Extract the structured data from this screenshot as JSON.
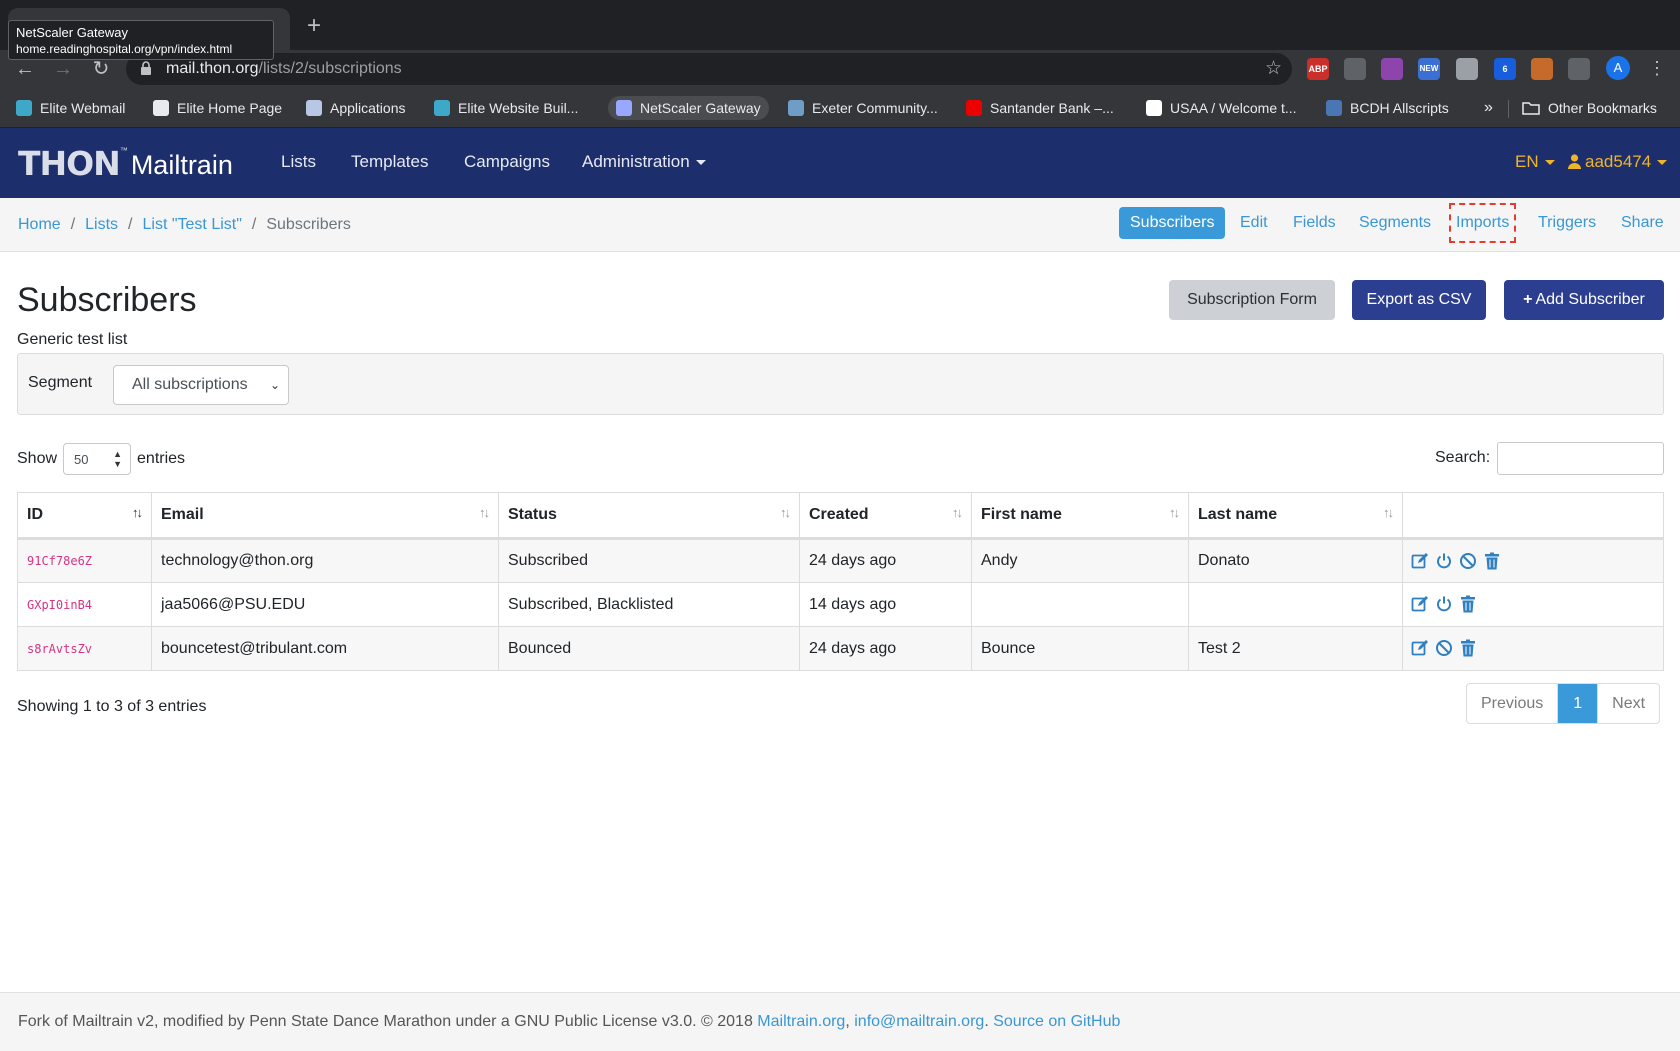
{
  "browser": {
    "tooltip_title": "NetScaler Gateway",
    "tooltip_url": "home.readinghospital.org/vpn/index.html",
    "url_host": "mail.thon.org",
    "url_path": "/lists/2/subscriptions",
    "extensions": [
      {
        "name": "adblock-plus",
        "label": "ABP",
        "color": "#c9302c"
      },
      {
        "name": "office",
        "label": "",
        "color": "#5f6368"
      },
      {
        "name": "color-wheel",
        "label": "",
        "color": "#8e44ad"
      },
      {
        "name": "new-extension",
        "label": "NEW",
        "color": "#3b6fd1"
      },
      {
        "name": "globe-extension",
        "label": "",
        "color": "#9aa0a6"
      },
      {
        "name": "bitwarden",
        "label": "6",
        "color": "#175ddc"
      },
      {
        "name": "basketball-extension",
        "label": "",
        "color": "#c56a2b"
      },
      {
        "name": "puzzle-extension",
        "label": "",
        "color": "#5f6368"
      }
    ],
    "avatar_letter": "A",
    "bookmarks": [
      {
        "label": "Elite Webmail",
        "icon_color": "#3ea8c9"
      },
      {
        "label": "Elite Home Page",
        "icon_color": "#e8eaed"
      },
      {
        "label": "Applications",
        "icon_color": "#b9c7e6"
      },
      {
        "label": "Elite Website Buil...",
        "icon_color": "#3ea8c9"
      },
      {
        "label": "NetScaler Gateway",
        "icon_color": "#9aa7ff"
      },
      {
        "label": "Exeter Community...",
        "icon_color": "#6e9dc7"
      },
      {
        "label": "Santander Bank –...",
        "icon_color": "#ec0000"
      },
      {
        "label": "USAA / Welcome t...",
        "icon_color": "#ffffff"
      },
      {
        "label": "BCDH Allscripts",
        "icon_color": "#4a77b3"
      }
    ],
    "bookmarks_more": "»",
    "other_bookmarks": "Other Bookmarks"
  },
  "nav": {
    "logo_thon": "THON",
    "logo_tm": "™",
    "logo_mailtrain": "Mailtrain",
    "links": [
      "Lists",
      "Templates",
      "Campaigns",
      "Administration"
    ],
    "lang": "EN",
    "user": "aad5474"
  },
  "breadcrumb": {
    "items": [
      "Home",
      "Lists",
      "List \"Test List\"",
      "Subscribers"
    ],
    "separator": "/"
  },
  "tabs": [
    "Subscribers",
    "Edit",
    "Fields",
    "Segments",
    "Imports",
    "Triggers",
    "Share"
  ],
  "page": {
    "title": "Subscribers",
    "subtitle": "Generic test list",
    "buttons": {
      "subscription_form": "Subscription Form",
      "export_csv": "Export as CSV",
      "add_subscriber": "Add Subscriber"
    },
    "segment_label": "Segment",
    "segment_value": "All subscriptions"
  },
  "datatable": {
    "show_label": "Show",
    "page_length": "50",
    "entries_label": "entries",
    "search_label": "Search:",
    "columns": [
      "ID",
      "Email",
      "Status",
      "Created",
      "First name",
      "Last name",
      ""
    ],
    "rows": [
      {
        "id": "91Cf78e6Z",
        "email": "technology@thon.org",
        "status": "Subscribed",
        "created": "24 days ago",
        "first": "Andy",
        "last": "Donato",
        "actions": [
          "edit-icon",
          "power-icon",
          "ban-icon",
          "trash-icon"
        ]
      },
      {
        "id": "GXpI0inB4",
        "email": "jaa5066@PSU.EDU",
        "status": "Subscribed, Blacklisted",
        "created": "14 days ago",
        "first": "",
        "last": "",
        "actions": [
          "edit-icon",
          "power-icon",
          "trash-icon"
        ]
      },
      {
        "id": "s8rAvtsZv",
        "email": "bouncetest@tribulant.com",
        "status": "Bounced",
        "created": "24 days ago",
        "first": "Bounce",
        "last": "Test 2",
        "actions": [
          "edit-icon",
          "ban-icon",
          "trash-icon"
        ]
      }
    ],
    "info": "Showing 1 to 3 of 3 entries",
    "pager": {
      "previous": "Previous",
      "current": "1",
      "next": "Next"
    }
  },
  "footer": {
    "text": "Fork of Mailtrain v2, modified by Penn State Dance Marathon under a GNU Public License v3.0. © 2018",
    "link1": "Mailtrain.org",
    "sep1": ",",
    "link2": "info@mailtrain.org",
    "sep2": ".",
    "link3": "Source on GitHub"
  },
  "colors": {
    "navbar": "#1d2e6c",
    "accent": "#3a9ad9",
    "primary_button": "#2c3e8f",
    "link": "#3a97d4",
    "highlight_box": "#e63b2e"
  }
}
